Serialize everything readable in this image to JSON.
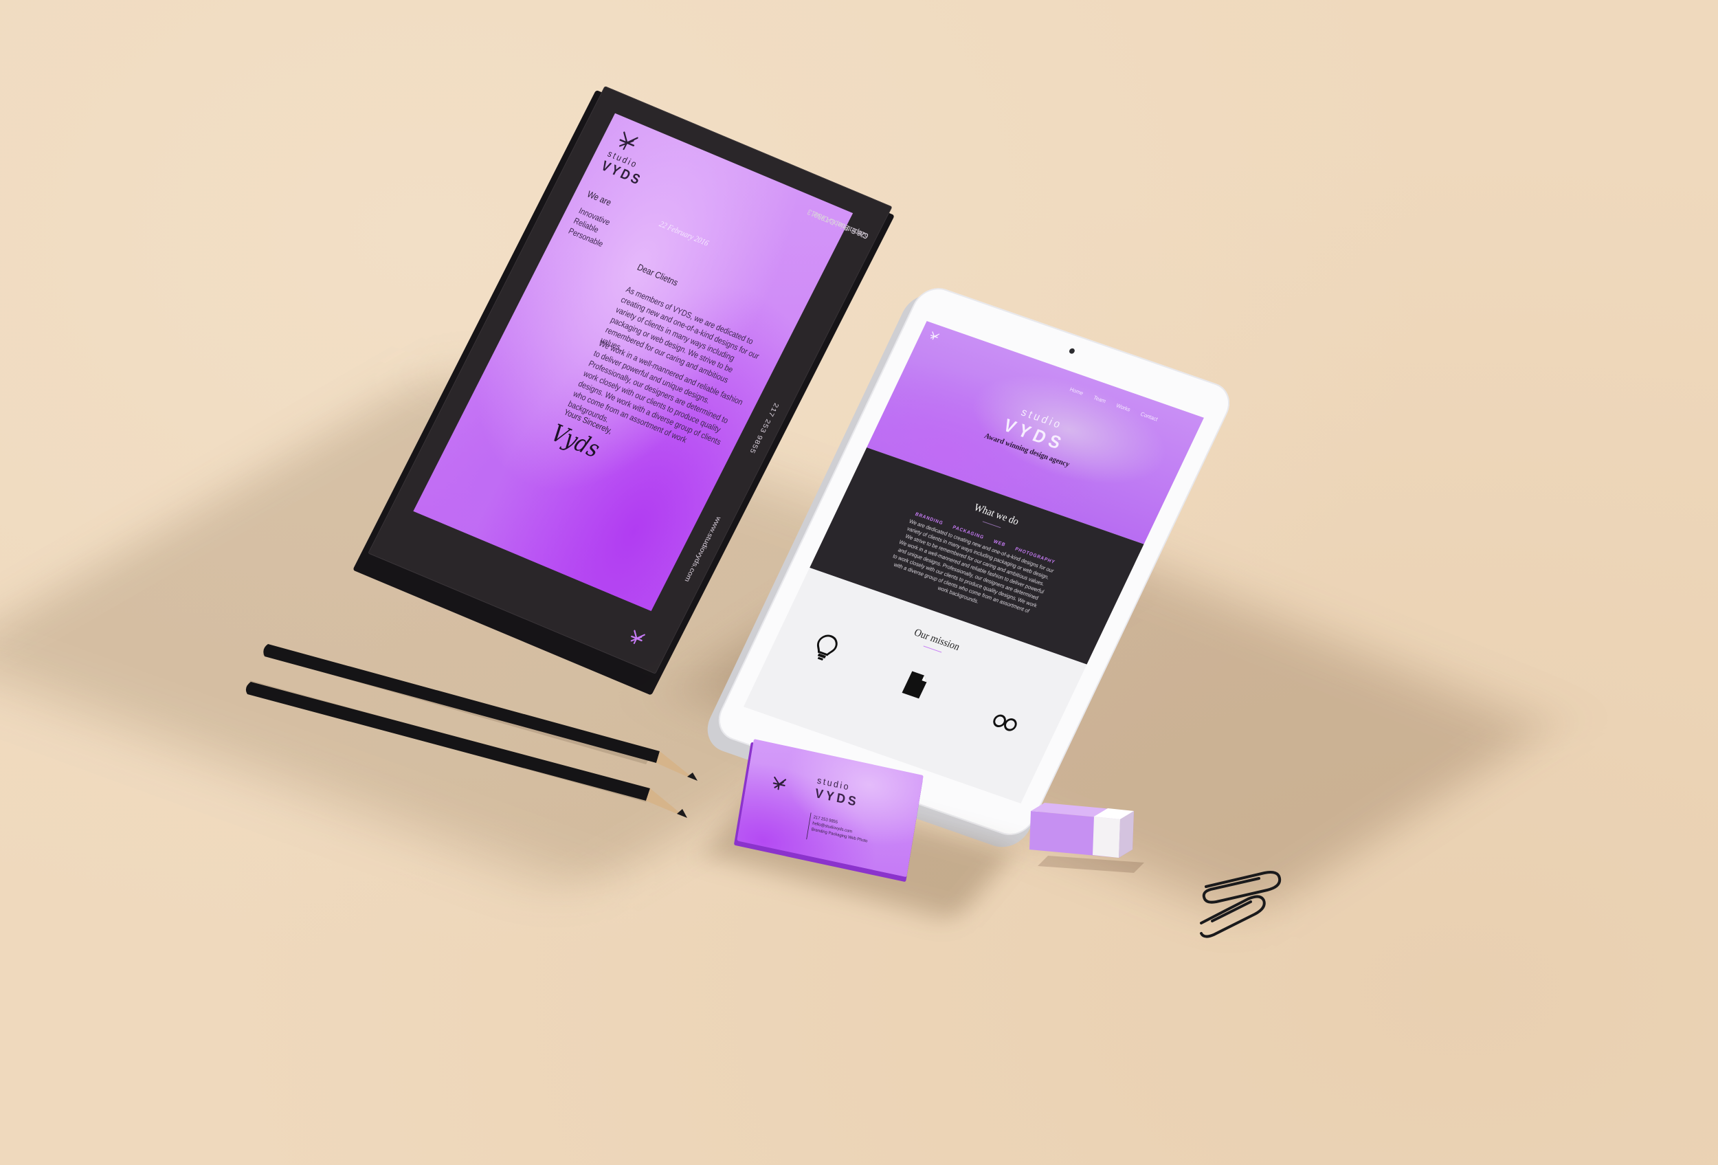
{
  "colors": {
    "background": "#efd9bd",
    "purple_light": "#d69cf8",
    "purple_deep": "#b13cf2",
    "folder_dark": "#2a2629",
    "accent": "#c77cf6"
  },
  "letterhead": {
    "logo_icon": "vyds-knot-logo",
    "brand_small": "studio",
    "brand_large": "VYDS",
    "we_are": "We are",
    "values": [
      "Innovative",
      "Reliable",
      "Personable"
    ],
    "date": "22 February 2016",
    "greeting": "Dear Clietns",
    "paragraph_1": "As members of VYDS, we are dedicated to creating new and one-of-a-kind designs for our variety of clients in many ways including packaging or web design. We strive to be remembered for our caring and ambitious values.",
    "paragraph_2": "We work in a well-mannered and reliable fashion to deliver powerful and unique designs. Professionally, our designers are determined to work closely with our clients to produce quality designs. We work with a diverse group of clients who come from an assortment of work backgrounds.",
    "signoff": "Yours Sincerely,",
    "signature": "Vyds",
    "side_address_1": "628 E. Pueblo Drive",
    "side_address_2": "Carpinteria, CA 93013",
    "side_phone": "217 253 9855",
    "side_web": "www.studiovyds.com"
  },
  "tablet": {
    "nav": [
      "Home",
      "Team",
      "Works",
      "Contact"
    ],
    "hero_small": "studio",
    "hero_large": "VYDS",
    "tagline": "Award winning design agency",
    "section_title": "What we do",
    "categories": [
      "BRANDING",
      "PACKAGING",
      "WEB",
      "PHOTOGRAPHY"
    ],
    "section_body": "We are dedicated to creating new and one-of-a-kind designs for our variety of clients in many ways including packaging or web design. We strive to be remembered for our caring and ambitious values. We work in a well-mannered and reliable fashion to deliver powerful and unique designs. Professionally, our designers are determined to work closely with our clients to produce quality designs. We work with a diverse group of clients who come from an assortment of work backgrounds.",
    "mission_title": "Our mission",
    "mission_icons": [
      "lightbulb-icon",
      "document-icon",
      "people-icon"
    ]
  },
  "business_card": {
    "brand_small": "studio",
    "brand_large": "VYDS",
    "info_lines": [
      "217 253 9855",
      "hello@studiovyds.com",
      "Branding Packaging Web Photo"
    ]
  }
}
